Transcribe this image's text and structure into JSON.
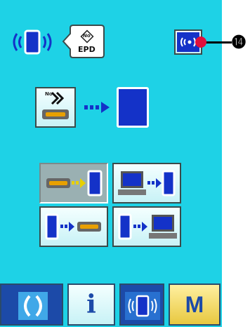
{
  "header": {
    "status_icon": "device-wireless-icon",
    "epd_icon_label": "EPD",
    "epd_number_mark": "No",
    "wireless_button_icon": "wireless-icon"
  },
  "transfer_preview": {
    "source_number_mark": "No",
    "arrow_icon": "dotted-arrow-right-icon",
    "target_icon": "device-icon"
  },
  "buttons": [
    {
      "id": "medium-to-device",
      "selected": true
    },
    {
      "id": "pc-to-device",
      "selected": false
    },
    {
      "id": "device-to-medium",
      "selected": false
    },
    {
      "id": "device-to-pc",
      "selected": false
    }
  ],
  "callout": {
    "label": "⓮"
  },
  "footer": {
    "ready_icon": "ready-icon",
    "info_label": "i",
    "comm_icon": "communication-icon",
    "mode_label": "M"
  },
  "colors": {
    "panel": "#1ed2e6",
    "device_blue": "#1432c8",
    "accent_red": "#e0103c",
    "footer_blue": "#1c4aa8"
  }
}
